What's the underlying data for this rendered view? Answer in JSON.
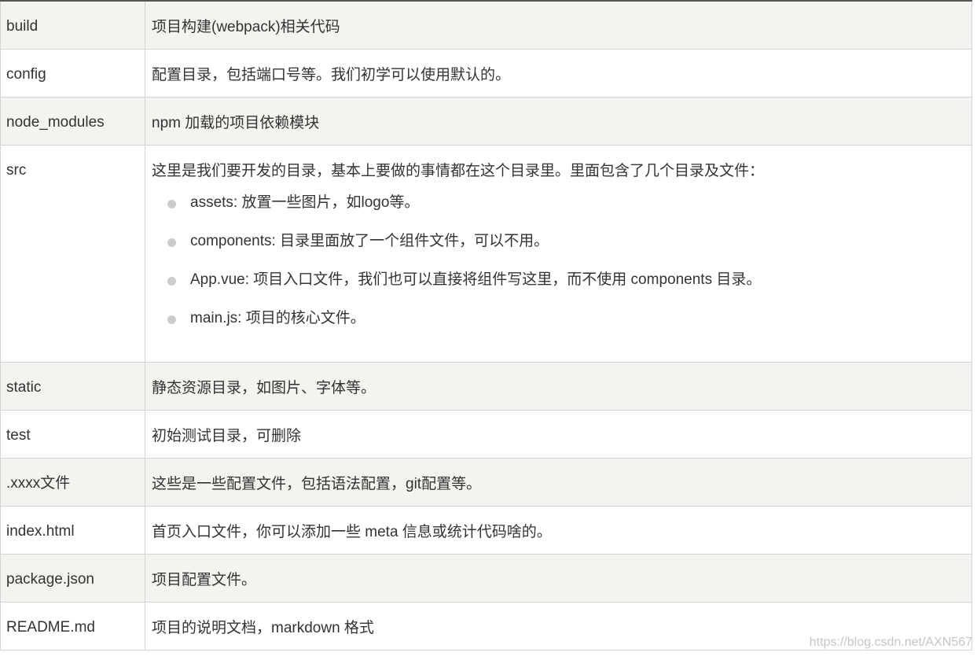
{
  "rows": [
    {
      "name": "build",
      "desc": "项目构建(webpack)相关代码"
    },
    {
      "name": "config",
      "desc": "配置目录，包括端口号等。我们初学可以使用默认的。"
    },
    {
      "name": "node_modules",
      "desc": "npm 加载的项目依赖模块"
    },
    {
      "name": "src",
      "desc": "这里是我们要开发的目录，基本上要做的事情都在这个目录里。里面包含了几个目录及文件：",
      "items": [
        "assets: 放置一些图片，如logo等。",
        "components: 目录里面放了一个组件文件，可以不用。",
        "App.vue: 项目入口文件，我们也可以直接将组件写这里，而不使用 components 目录。",
        "main.js: 项目的核心文件。"
      ]
    },
    {
      "name": "static",
      "desc": "静态资源目录，如图片、字体等。"
    },
    {
      "name": "test",
      "desc": "初始测试目录，可删除"
    },
    {
      "name": ".xxxx文件",
      "desc": "这些是一些配置文件，包括语法配置，git配置等。"
    },
    {
      "name": "index.html",
      "desc": "首页入口文件，你可以添加一些 meta 信息或统计代码啥的。"
    },
    {
      "name": "package.json",
      "desc": "项目配置文件。"
    },
    {
      "name": "README.md",
      "desc": "项目的说明文档，markdown 格式"
    }
  ],
  "watermark": "https://blog.csdn.net/AXN567",
  "colors": {
    "shaded_row": "#f4f3ef",
    "plain_row": "#ffffff",
    "border": "#d4d4d4",
    "text": "#333333",
    "bullet": "#cccccc"
  }
}
